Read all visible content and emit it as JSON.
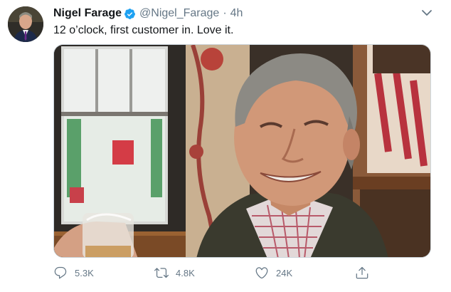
{
  "author": {
    "name": "Nigel Farage",
    "handle": "@Nigel_Farage",
    "separator": "·",
    "time": "4h",
    "verified": true
  },
  "tweet": {
    "text": "12 o’clock, first customer in. Love it."
  },
  "actions": {
    "reply_count": "5.3K",
    "retweet_count": "4.8K",
    "like_count": "24K"
  },
  "colors": {
    "verified_blue": "#1da1f2",
    "secondary_text": "#657786",
    "primary_text": "#14171a"
  },
  "icons": {
    "verified": "verified-badge-icon",
    "caret": "chevron-down-icon",
    "reply": "reply-icon",
    "retweet": "retweet-icon",
    "like": "heart-icon",
    "share": "share-icon"
  }
}
